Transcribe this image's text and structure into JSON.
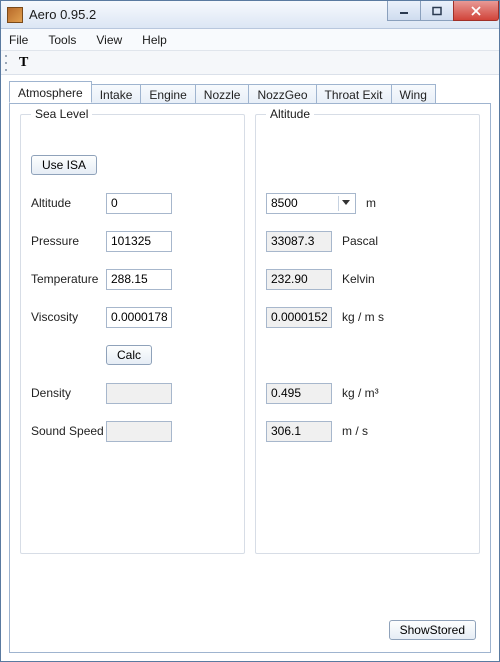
{
  "window": {
    "title": "Aero 0.95.2"
  },
  "menu": {
    "file": "File",
    "tools": "Tools",
    "view": "View",
    "help": "Help"
  },
  "tabs": {
    "atmosphere": "Atmosphere",
    "intake": "Intake",
    "engine": "Engine",
    "nozzle": "Nozzle",
    "nozzgeo": "NozzGeo",
    "throat_exit": "Throat Exit",
    "wing": "Wing"
  },
  "sea_level": {
    "legend": "Sea Level",
    "use_isa_btn": "Use ISA",
    "labels": {
      "altitude": "Altitude",
      "pressure": "Pressure",
      "temperature": "Temperature",
      "viscosity": "Viscosity",
      "density": "Density",
      "sound_speed": "Sound Speed"
    },
    "values": {
      "altitude": "0",
      "pressure": "101325",
      "temperature": "288.15",
      "viscosity": "0.0000178",
      "density": "",
      "sound_speed": ""
    },
    "calc_btn": "Calc"
  },
  "altitude": {
    "legend": "Altitude",
    "combo_value": "8500",
    "values": {
      "pressure": "33087.3",
      "temperature": "232.90",
      "viscosity": "0.0000152",
      "density": "0.495",
      "sound_speed": "306.1"
    },
    "units": {
      "altitude": "m",
      "pressure": "Pascal",
      "temperature": "Kelvin",
      "viscosity": "kg / m s",
      "density": "kg / m³",
      "sound_speed": "m / s"
    }
  },
  "buttons": {
    "show_stored": "ShowStored"
  }
}
